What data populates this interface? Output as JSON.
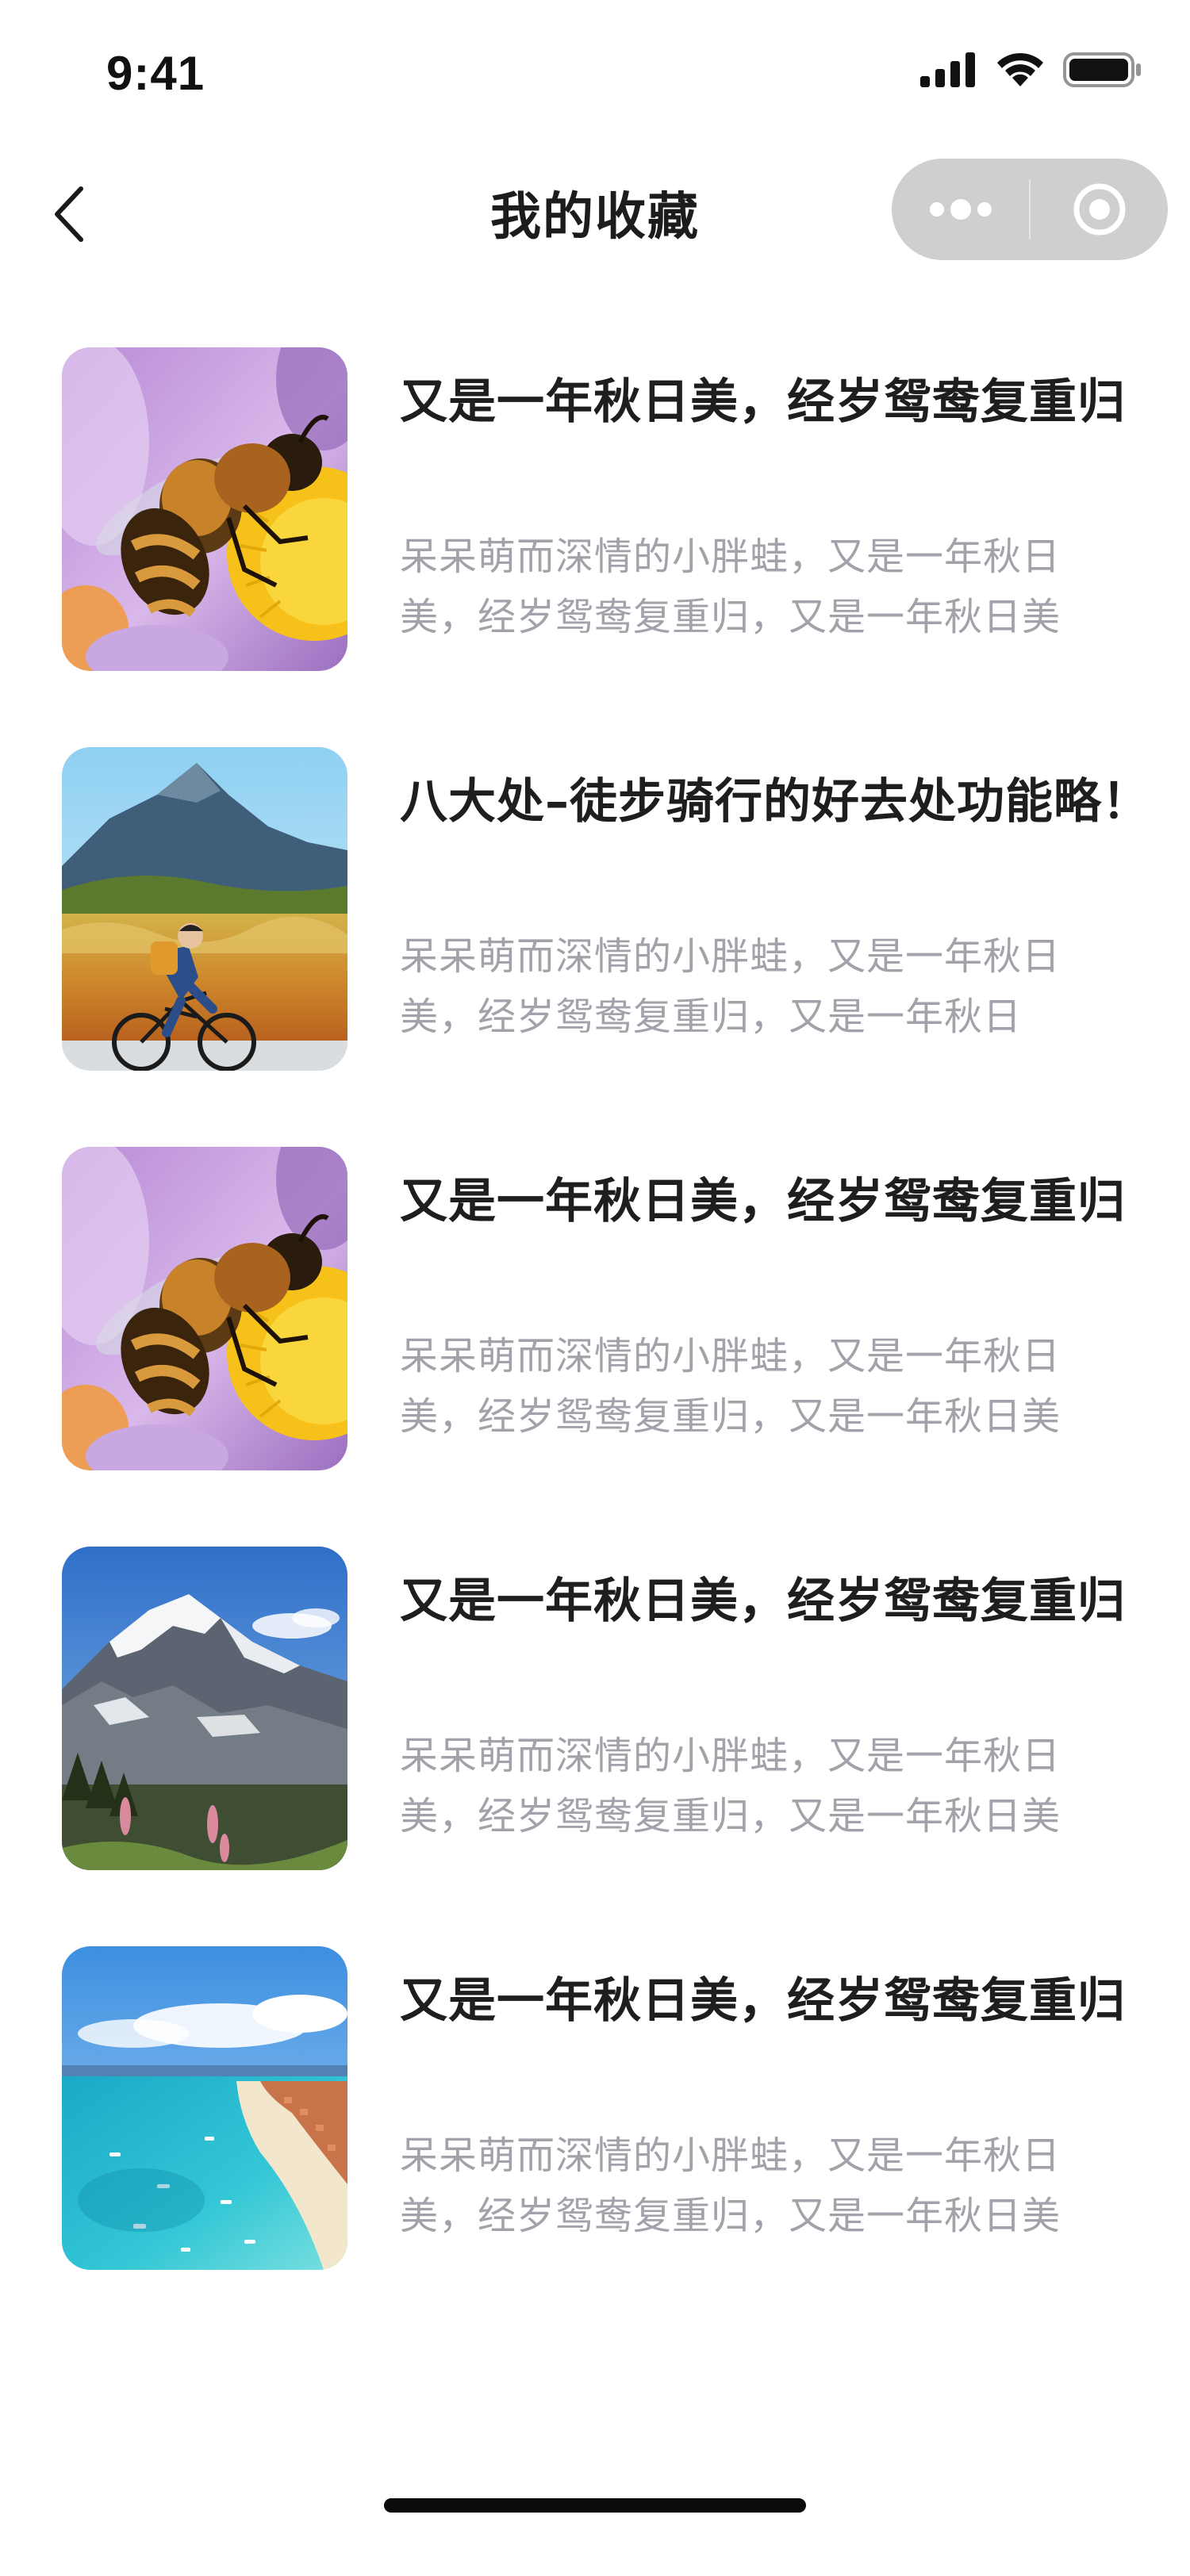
{
  "status_bar": {
    "time": "9:41"
  },
  "nav": {
    "title": "我的收藏",
    "back_icon": "chevron-left-icon",
    "more_icon": "more-dots-icon",
    "close_icon": "target-circle-icon"
  },
  "items": [
    {
      "title": "又是一年秋日美，经岁鸳鸯复重归",
      "desc": "呆呆萌而深情的小胖蛙，又是一年秋日美，经岁鸳鸯复重归，又是一年秋日美",
      "image": "bee-on-flower"
    },
    {
      "title": "八大处–徒步骑行的好去处功能略！",
      "desc": "呆呆萌而深情的小胖蛙，又是一年秋日美，经岁鸳鸯复重归，又是一年秋日",
      "image": "cyclist-mountain"
    },
    {
      "title": "又是一年秋日美，经岁鸳鸯复重归",
      "desc": "呆呆萌而深情的小胖蛙，又是一年秋日美，经岁鸳鸯复重归，又是一年秋日美",
      "image": "bee-on-flower"
    },
    {
      "title": "又是一年秋日美，经岁鸳鸯复重归",
      "desc": "呆呆萌而深情的小胖蛙，又是一年秋日美，经岁鸳鸯复重归，又是一年秋日美",
      "image": "snowy-mountain"
    },
    {
      "title": "又是一年秋日美，经岁鸳鸯复重归",
      "desc": "呆呆萌而深情的小胖蛙，又是一年秋日美，经岁鸳鸯复重归，又是一年秋日美",
      "image": "tropical-beach"
    }
  ]
}
